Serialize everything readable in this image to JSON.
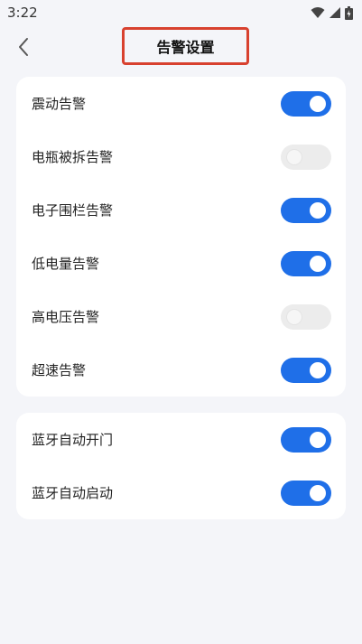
{
  "status": {
    "time": "3:22"
  },
  "header": {
    "title": "告警设置"
  },
  "alarms": [
    {
      "label": "震动告警",
      "on": true
    },
    {
      "label": "电瓶被拆告警",
      "on": false
    },
    {
      "label": "电子围栏告警",
      "on": true
    },
    {
      "label": "低电量告警",
      "on": true
    },
    {
      "label": "高电压告警",
      "on": false
    },
    {
      "label": "超速告警",
      "on": true
    }
  ],
  "bluetooth": [
    {
      "label": "蓝牙自动开门",
      "on": true
    },
    {
      "label": "蓝牙自动启动",
      "on": true
    }
  ],
  "colors": {
    "accent": "#1f6fe8",
    "highlight_box": "#d8412f",
    "background": "#f4f5f9"
  }
}
